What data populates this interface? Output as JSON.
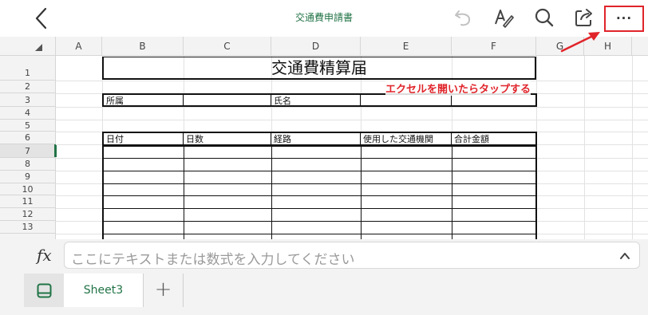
{
  "app": {
    "accent_color": "#217346",
    "annotation_color": "#e0242a"
  },
  "topbar": {
    "title": "交通費申請書",
    "icons": [
      "back-icon",
      "undo-icon",
      "draw-icon",
      "search-icon",
      "share-icon",
      "more-icon"
    ],
    "more_label": "···"
  },
  "annotation": {
    "text": "エクセルを開いたらタップする"
  },
  "sheet": {
    "columns": [
      "A",
      "B",
      "C",
      "D",
      "E",
      "F",
      "G",
      "H"
    ],
    "rows": [
      "1",
      "2",
      "3",
      "4",
      "5",
      "6",
      "7",
      "8",
      "9",
      "10",
      "11",
      "12",
      "13"
    ],
    "selected_row": "7",
    "form": {
      "title": "交通費精算届",
      "affiliation_label": "所属",
      "name_label": "氏名",
      "table_headers": [
        "日付",
        "日数",
        "経路",
        "使用した交通機関",
        "合計金額"
      ]
    }
  },
  "formula_bar": {
    "fx_label": "fx",
    "placeholder": "ここにテキストまたは数式を入力してください"
  },
  "tabs": {
    "active": "Sheet3",
    "add_label": "+"
  }
}
